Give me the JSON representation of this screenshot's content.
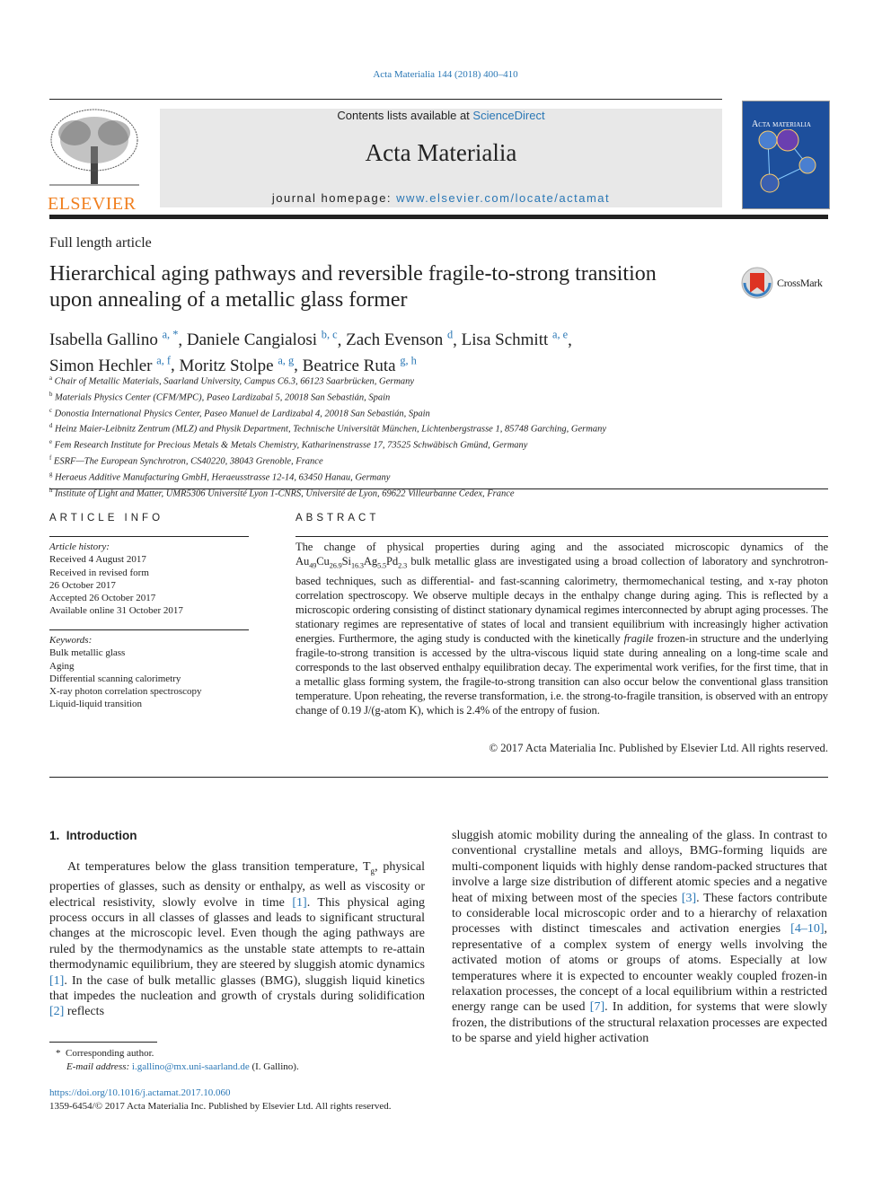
{
  "citation": "Acta Materialia 144 (2018) 400–410",
  "header": {
    "publisher_logo": "ELSEVIER",
    "contents_prefix": "Contents lists available at ",
    "contents_link": "ScienceDirect",
    "journal_title": "Acta Materialia",
    "homepage_prefix": "journal homepage: ",
    "homepage_link": "www.elsevier.com/locate/actamat",
    "cover_text": "Acta materialia"
  },
  "article_type": "Full length article",
  "title": "Hierarchical aging pathways and reversible fragile-to-strong transition upon annealing of a metallic glass former",
  "crossmark": "CrossMark",
  "authors": [
    {
      "name": "Isabella Gallino",
      "aff": "a, *",
      "sep": ", "
    },
    {
      "name": "Daniele Cangialosi",
      "aff": "b, c",
      "sep": ", "
    },
    {
      "name": "Zach Evenson",
      "aff": "d",
      "sep": ", "
    },
    {
      "name": "Lisa Schmitt",
      "aff": "a, e",
      "sep": ","
    },
    {
      "name": "Simon Hechler",
      "aff": "a, f",
      "sep": ", "
    },
    {
      "name": "Moritz Stolpe",
      "aff": "a, g",
      "sep": ", "
    },
    {
      "name": "Beatrice Ruta",
      "aff": "g, h",
      "sep": ""
    }
  ],
  "affiliations": [
    {
      "key": "a",
      "text": "Chair of Metallic Materials, Saarland University, Campus C6.3, 66123 Saarbrücken, Germany"
    },
    {
      "key": "b",
      "text": "Materials Physics Center (CFM/MPC), Paseo Lardizabal 5, 20018 San Sebastián, Spain"
    },
    {
      "key": "c",
      "text": "Donostia International Physics Center, Paseo Manuel de Lardizabal 4, 20018 San Sebastián, Spain"
    },
    {
      "key": "d",
      "text": "Heinz Maier-Leibnitz Zentrum (MLZ) and Physik Department, Technische Universität München, Lichtenbergstrasse 1, 85748 Garching, Germany"
    },
    {
      "key": "e",
      "text": "Fem Research Institute for Precious Metals & Metals Chemistry, Katharinenstrasse 17, 73525 Schwäbisch Gmünd, Germany"
    },
    {
      "key": "f",
      "text": "ESRF—The European Synchrotron, CS40220, 38043 Grenoble, France"
    },
    {
      "key": "g",
      "text": "Heraeus Additive Manufacturing GmbH, Heraeusstrasse 12-14, 63450 Hanau, Germany"
    },
    {
      "key": "h",
      "text": "Institute of Light and Matter, UMR5306 Université Lyon 1-CNRS, Université de Lyon, 69622 Villeurbanne Cedex, France"
    }
  ],
  "article_info": {
    "heading": "ARTICLE INFO",
    "history_label": "Article history:",
    "history": [
      "Received 4 August 2017",
      "Received in revised form",
      "26 October 2017",
      "Accepted 26 October 2017",
      "Available online 31 October 2017"
    ],
    "keywords_label": "Keywords:",
    "keywords": [
      "Bulk metallic glass",
      "Aging",
      "Differential scanning calorimetry",
      "X-ray photon correlation spectroscopy",
      "Liquid-liquid transition"
    ]
  },
  "abstract": {
    "heading": "ABSTRACT",
    "p1": "The change of physical properties during aging and the associated microscopic dynamics of the ",
    "formula": [
      [
        "Au",
        "49"
      ],
      [
        "Cu",
        "26.9"
      ],
      [
        "Si",
        "16.3"
      ],
      [
        "Ag",
        "5.5"
      ],
      [
        "Pd",
        "2.3"
      ]
    ],
    "p2": " bulk metallic glass are investigated using a broad collection of laboratory and synchrotron-based techniques, such as differential- and fast-scanning calorimetry, thermomechanical testing, and x-ray photon correlation spectroscopy. We observe multiple decays in the enthalpy change during aging. This is reflected by a microscopic ordering consisting of distinct stationary dynamical regimes interconnected by abrupt aging processes. The stationary regimes are representative of states of local and transient equilibrium with increasingly higher activation energies. Furthermore, the aging study is conducted with the kinetically ",
    "italic": "fragile",
    "p3": " frozen-in structure and the underlying fragile-to-strong transition is accessed by the ultra-viscous liquid state during annealing on a long-time scale and corresponds to the last observed enthalpy equilibration decay. The experimental work verifies, for the first time, that in a metallic glass forming system, the fragile-to-strong transition can also occur below the conventional glass transition temperature. Upon reheating, the reverse transformation, i.e. the strong-to-fragile transition, is observed with an entropy change of 0.19 J/(g-atom K), which is 2.4% of the entropy of fusion.",
    "copyright": "© 2017 Acta Materialia Inc. Published by Elsevier Ltd. All rights reserved."
  },
  "intro": {
    "heading": "1.  Introduction",
    "left": [
      {
        "t": "At temperatures below the glass transition temperature, T"
      },
      {
        "sub": "g"
      },
      {
        "t": ", physical properties of glasses, such as density or enthalpy, as well as viscosity or electrical resistivity, slowly evolve in time "
      },
      {
        "ref": "[1]"
      },
      {
        "t": ". This physical aging process occurs in all classes of glasses and leads to significant structural changes at the microscopic level. Even though the aging pathways are ruled by the thermodynamics as the unstable state attempts to re-attain thermodynamic equilibrium, they are steered by sluggish atomic dynamics "
      },
      {
        "ref": "[1]"
      },
      {
        "t": ". In the case of bulk metallic glasses (BMG), sluggish liquid kinetics that impedes the nucleation and growth of crystals during solidification "
      },
      {
        "ref": "[2]"
      },
      {
        "t": " reflects"
      }
    ],
    "right": [
      {
        "t": "sluggish atomic mobility during the annealing of the glass. In contrast to conventional crystalline metals and alloys, BMG-forming liquids are multi-component liquids with highly dense random-packed structures that involve a large size distribution of different atomic species and a negative heat of mixing between most of the species "
      },
      {
        "ref": "[3]"
      },
      {
        "t": ". These factors contribute to considerable local microscopic order and to a hierarchy of relaxation processes with distinct timescales and activation energies "
      },
      {
        "ref": "[4–10]"
      },
      {
        "t": ", representative of a complex system of energy wells involving the activated motion of atoms or groups of atoms. Especially at low temperatures where it is expected to encounter weakly coupled frozen-in relaxation processes, the concept of a local equilibrium within a restricted energy range can be used "
      },
      {
        "ref": "[7]"
      },
      {
        "t": ". In addition, for systems that were slowly frozen, the distributions of the structural relaxation processes are expected to be sparse and yield higher activation"
      }
    ]
  },
  "footnote": {
    "star": "*",
    "corresponding": "Corresponding author.",
    "email_label": "E-mail address:",
    "email": "i.gallino@mx.uni-saarland.de",
    "email_suffix": " (I. Gallino)."
  },
  "doi": "https://doi.org/10.1016/j.actamat.2017.10.060",
  "issn_line": "1359-6454/© 2017 Acta Materialia Inc. Published by Elsevier Ltd. All rights reserved.",
  "colors": {
    "link": "#2a77b5",
    "elsevier_orange": "#f07f1e",
    "header_gray": "#e8e8e8"
  }
}
